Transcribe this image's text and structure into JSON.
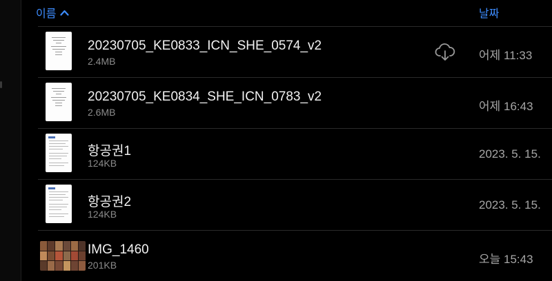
{
  "header": {
    "sort_name_label": "이름",
    "sort_date_label": "날짜"
  },
  "files": [
    {
      "name": "20230705_KE0833_ICN_SHE_0574_v2",
      "size": "2.4MB",
      "date": "어제 11:33",
      "thumb": "doc-ticket",
      "cloud_download": true
    },
    {
      "name": "20230705_KE0834_SHE_ICN_0783_v2",
      "size": "2.6MB",
      "date": "어제 16:43",
      "thumb": "doc-ticket",
      "cloud_download": false
    },
    {
      "name": "항공권1",
      "size": "124KB",
      "date": "2023. 5. 15.",
      "thumb": "doc",
      "cloud_download": false
    },
    {
      "name": "항공권2",
      "size": "124KB",
      "date": "2023. 5. 15.",
      "thumb": "doc",
      "cloud_download": false
    },
    {
      "name": "IMG_1460",
      "size": "201KB",
      "date": "오늘 15:43",
      "thumb": "photo",
      "cloud_download": false
    }
  ],
  "colors": {
    "accent": "#3d8cff",
    "background": "#000000",
    "secondary_text": "#8b8b8b"
  }
}
